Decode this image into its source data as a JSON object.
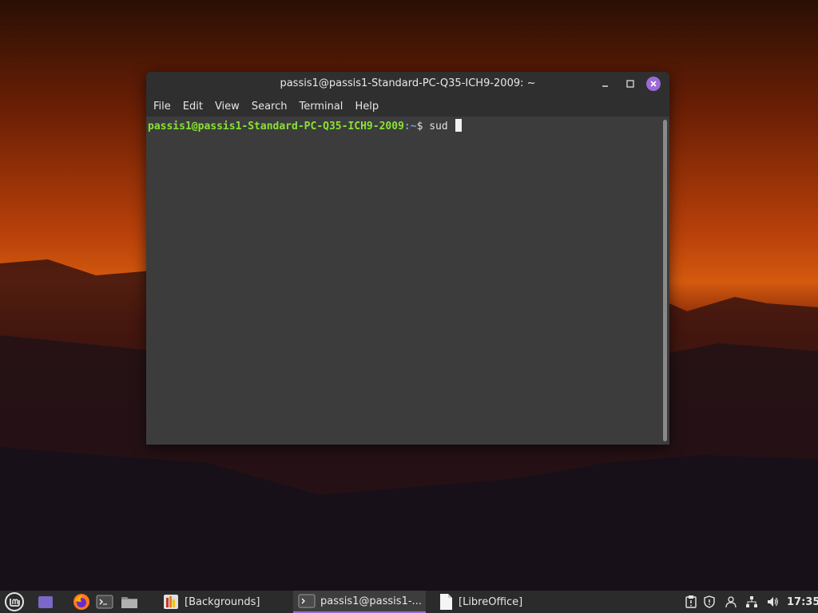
{
  "window": {
    "title": "passis1@passis1-Standard-PC-Q35-ICH9-2009: ~",
    "menu": [
      "File",
      "Edit",
      "View",
      "Search",
      "Terminal",
      "Help"
    ]
  },
  "terminal": {
    "user_host": "passis1@passis1-Standard-PC-Q35-ICH9-2009",
    "path": ":~",
    "prompt_symbol": "$ ",
    "input": "sud "
  },
  "taskbar": {
    "tasks": [
      {
        "label": "[Backgrounds]"
      },
      {
        "label": "passis1@passis1-..."
      },
      {
        "label": "[LibreOffice]"
      }
    ],
    "clock": "17:35"
  },
  "colors": {
    "accent": "#9a6ad8",
    "prompt_user": "#8ae234",
    "prompt_path": "#729fcf"
  }
}
